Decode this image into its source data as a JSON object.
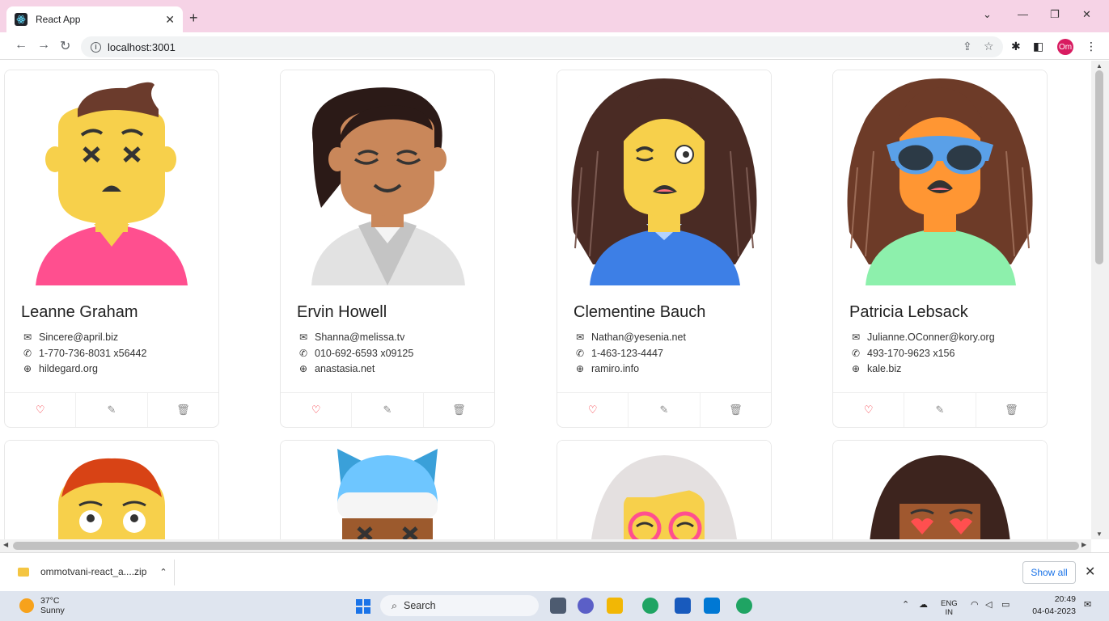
{
  "browser": {
    "tab_title": "React App",
    "url": "localhost:3001",
    "profile_initials": "Om"
  },
  "cards": [
    {
      "name": "Leanne Graham",
      "email": "Sincere@april.biz",
      "phone": "1-770-736-8031 x56442",
      "website": "hildegard.org"
    },
    {
      "name": "Ervin Howell",
      "email": "Shanna@melissa.tv",
      "phone": "010-692-6593 x09125",
      "website": "anastasia.net"
    },
    {
      "name": "Clementine Bauch",
      "email": "Nathan@yesenia.net",
      "phone": "1-463-123-4447",
      "website": "ramiro.info"
    },
    {
      "name": "Patricia Lebsack",
      "email": "Julianne.OConner@kory.org",
      "phone": "493-170-9623 x156",
      "website": "kale.biz"
    }
  ],
  "downloads": {
    "file_name": "ommotvani-react_a....zip",
    "show_all_label": "Show all"
  },
  "taskbar": {
    "temperature": "37°C",
    "weather": "Sunny",
    "search_label": "Search",
    "language": "ENG",
    "region": "IN",
    "time": "20:49",
    "date": "04-04-2023"
  },
  "colors": {
    "heart": "#f5222d",
    "tab_strip": "#f6d3e6",
    "profile": "#d81b60"
  }
}
